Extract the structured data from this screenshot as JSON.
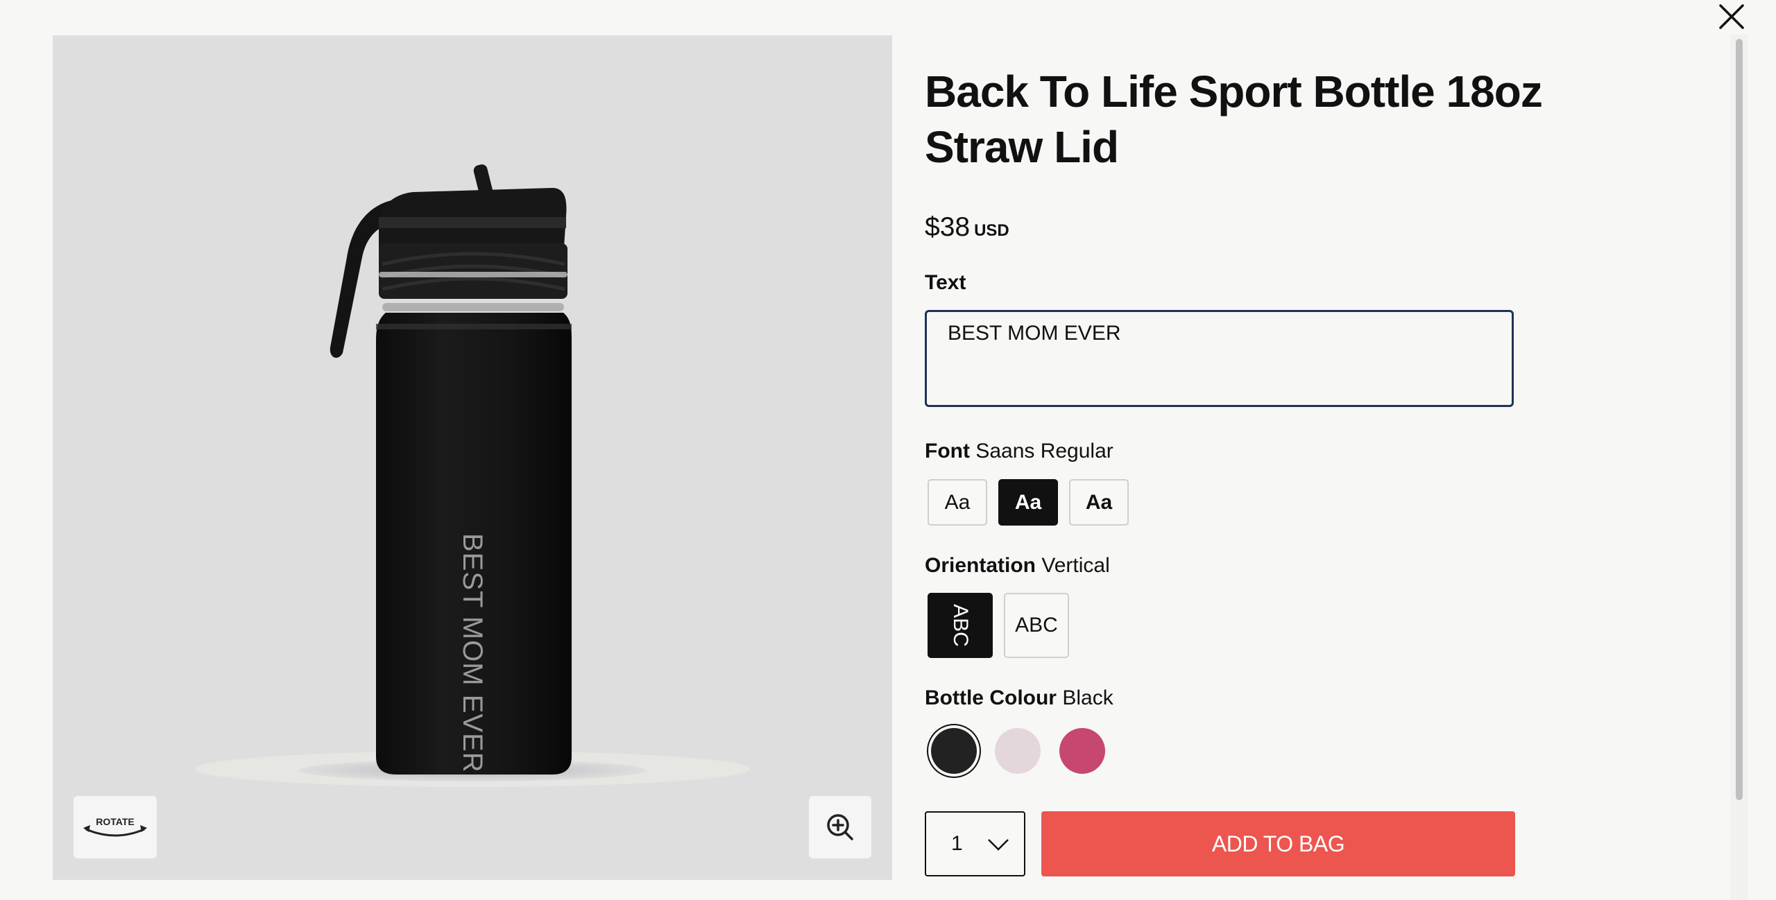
{
  "product": {
    "title": "Back To Life Sport Bottle 18oz Straw Lid",
    "price": "$38",
    "currency": "USD"
  },
  "engraving": {
    "text_label": "Text",
    "text_value": "BEST MOM EVER"
  },
  "font": {
    "label": "Font",
    "selected": "Saans Regular",
    "options": [
      "Aa",
      "Aa",
      "Aa"
    ]
  },
  "orientation": {
    "label": "Orientation",
    "selected": "Vertical",
    "options": [
      "ABC",
      "ABC"
    ]
  },
  "bottle_colour": {
    "label": "Bottle Colour",
    "selected": "Black",
    "swatches": [
      "#222222",
      "#e4d7dc",
      "#c7486f"
    ]
  },
  "viewer": {
    "rotate_label": "ROTATE",
    "engraving_preview": "BEST MOM EVER"
  },
  "cart": {
    "quantity": "1",
    "add_label": "ADD TO BAG"
  },
  "colors": {
    "accent": "#ec564f",
    "focus_border": "#1e3358"
  }
}
